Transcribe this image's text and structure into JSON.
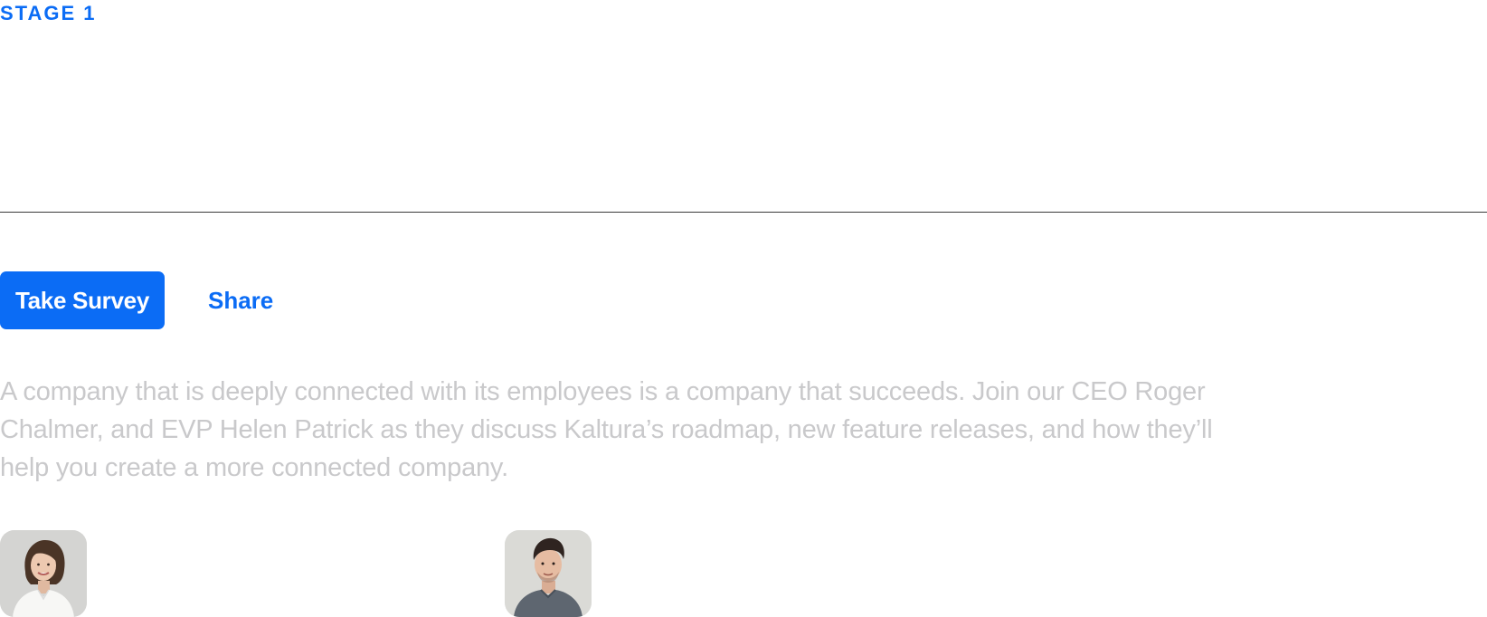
{
  "stage": {
    "label": "STAGE 1"
  },
  "actions": {
    "primary_label": "Take Survey",
    "secondary_label": "Share"
  },
  "description": "A company that is deeply connected with its employees is a company that succeeds. Join our CEO Roger Chalmer,  and EVP Helen Patrick as they discuss Kaltura’s roadmap, new feature releases, and how they’ll help you create a more connected company.",
  "speakers": [
    {
      "icon": "woman-portrait-avatar"
    },
    {
      "icon": "man-portrait-avatar"
    }
  ],
  "colors": {
    "accent": "#0b6cf5",
    "text_muted": "#c9c9cb",
    "divider": "#3a3a3a"
  }
}
